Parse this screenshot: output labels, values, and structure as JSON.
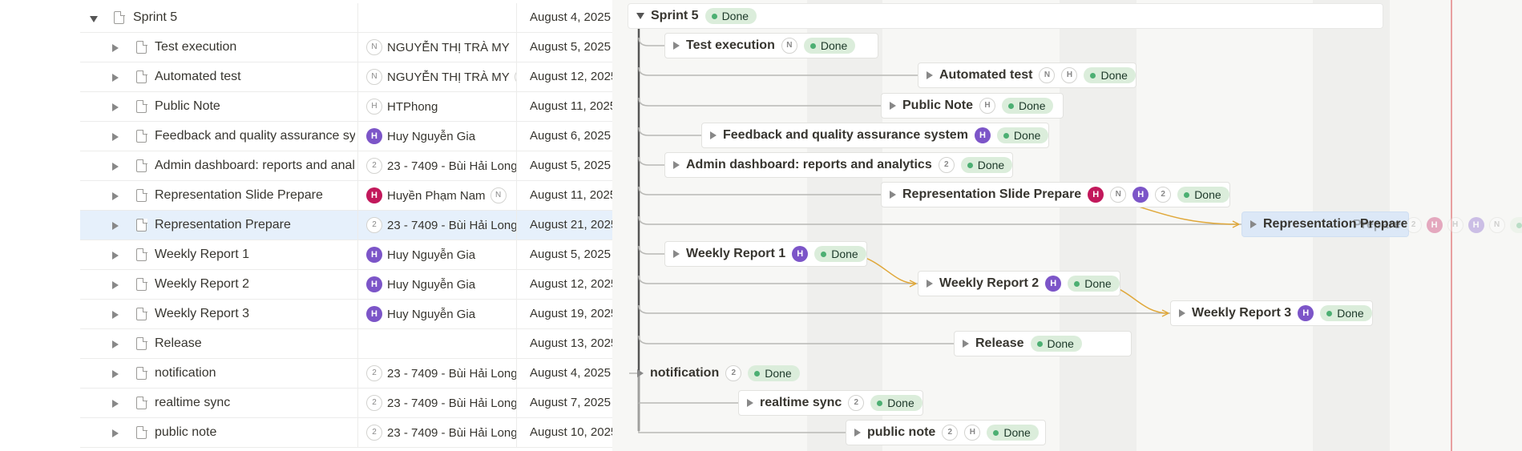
{
  "colors": {
    "status_done_bg": "#dbeddb",
    "status_done_dot": "#4caf72",
    "dependency_line": "#e0a83a",
    "selected_row": "#e6f0fb",
    "today_line": "#e8a0a0"
  },
  "table": {
    "rows": [
      {
        "title": "Sprint 5",
        "date": "August 4, 2025",
        "people": [],
        "people_text": ""
      },
      {
        "title": "Test execution",
        "date": "August 5, 2025",
        "people": [
          {
            "kind": "n",
            "label": "N"
          }
        ],
        "people_text": "NGUYỄN THỊ TRÀ MY"
      },
      {
        "title": "Automated test",
        "date": "August 12, 2025",
        "people": [
          {
            "kind": "n",
            "label": "N"
          }
        ],
        "people_text": "NGUYỄN THỊ TRÀ MY",
        "trailing": "H"
      },
      {
        "title": "Public Note",
        "date": "August 11, 2025",
        "people": [
          {
            "kind": "n",
            "label": "H"
          }
        ],
        "people_text": "HTPhong"
      },
      {
        "title": "Feedback and quality assurance system",
        "date": "August 6, 2025",
        "people": [
          {
            "kind": "purple",
            "label": "H"
          }
        ],
        "people_text": "Huy Nguyễn Gia"
      },
      {
        "title": "Admin dashboard: reports and analytics",
        "date": "August 5, 2025",
        "people": [
          {
            "kind": "num",
            "label": "2"
          }
        ],
        "people_text": "23 - 7409 - Bùi Hải Long"
      },
      {
        "title": "Representation Slide Prepare",
        "date": "August 11, 2025",
        "people": [
          {
            "kind": "red",
            "label": "H"
          }
        ],
        "people_text": "Huyền Phạm Nam",
        "trailing": "N"
      },
      {
        "title": "Representation Prepare",
        "date": "August 21, 2025",
        "people": [
          {
            "kind": "num",
            "label": "2"
          }
        ],
        "people_text": "23 - 7409 - Bùi Hải Long"
      },
      {
        "title": "Weekly Report 1",
        "date": "August 5, 2025",
        "people": [
          {
            "kind": "purple",
            "label": "H"
          }
        ],
        "people_text": "Huy Nguyễn Gia"
      },
      {
        "title": "Weekly Report 2",
        "date": "August 12, 2025",
        "people": [
          {
            "kind": "purple",
            "label": "H"
          }
        ],
        "people_text": "Huy Nguyễn Gia"
      },
      {
        "title": "Weekly Report 3",
        "date": "August 19, 2025",
        "people": [
          {
            "kind": "purple",
            "label": "H"
          }
        ],
        "people_text": "Huy Nguyễn Gia"
      },
      {
        "title": "Release",
        "date": "August 13, 2025",
        "people": [],
        "people_text": ""
      },
      {
        "title": "notification",
        "date": "August 4, 2025",
        "people": [
          {
            "kind": "num",
            "label": "2"
          }
        ],
        "people_text": "23 - 7409 - Bùi Hải Long"
      },
      {
        "title": "realtime sync",
        "date": "August 7, 2025",
        "people": [
          {
            "kind": "num",
            "label": "2"
          }
        ],
        "people_text": "23 - 7409 - Bùi Hải Long"
      },
      {
        "title": "public note",
        "date": "August 10, 2025",
        "people": [
          {
            "kind": "num",
            "label": "2"
          }
        ],
        "people_text": "23 - 7409 - Bùi Hải Long"
      }
    ]
  },
  "gantt": {
    "status_label": "Done",
    "bars": [
      {
        "name": "Sprint 5",
        "open": true,
        "avatars": []
      },
      {
        "name": "Test execution",
        "avatars": [
          {
            "kind": "n",
            "label": "N"
          }
        ]
      },
      {
        "name": "Automated test",
        "avatars": [
          {
            "kind": "n",
            "label": "N"
          },
          {
            "kind": "n",
            "label": "H"
          }
        ]
      },
      {
        "name": "Public Note",
        "avatars": [
          {
            "kind": "n",
            "label": "H"
          }
        ]
      },
      {
        "name": "Feedback and quality assurance system",
        "avatars": [
          {
            "kind": "purple",
            "label": "H"
          }
        ]
      },
      {
        "name": "Admin dashboard: reports and analytics",
        "avatars": [
          {
            "kind": "num",
            "label": "2"
          }
        ]
      },
      {
        "name": "Representation Slide Prepare",
        "avatars": [
          {
            "kind": "red",
            "label": "H"
          },
          {
            "kind": "n",
            "label": "N"
          },
          {
            "kind": "purple",
            "label": "H"
          },
          {
            "kind": "num",
            "label": "2"
          }
        ]
      },
      {
        "name": "Representation Prepare",
        "avatars": [],
        "faded_tail": "Prepare",
        "faded_avatars": [
          {
            "kind": "num",
            "label": "2"
          },
          {
            "kind": "red",
            "label": "H"
          },
          {
            "kind": "n",
            "label": "H"
          },
          {
            "kind": "purple",
            "label": "H"
          },
          {
            "kind": "n",
            "label": "N"
          }
        ],
        "faded_status": "D"
      },
      {
        "name": "Weekly Report 1",
        "avatars": [
          {
            "kind": "purple",
            "label": "H"
          }
        ]
      },
      {
        "name": "Weekly Report 2",
        "avatars": [
          {
            "kind": "purple",
            "label": "H"
          }
        ]
      },
      {
        "name": "Weekly Report 3",
        "avatars": [
          {
            "kind": "purple",
            "label": "H"
          }
        ]
      },
      {
        "name": "Release",
        "avatars": []
      },
      {
        "name": "notification",
        "avatars": [
          {
            "kind": "num",
            "label": "2"
          }
        ]
      },
      {
        "name": "realtime sync",
        "avatars": [
          {
            "kind": "num",
            "label": "2"
          }
        ]
      },
      {
        "name": "public note",
        "avatars": [
          {
            "kind": "num",
            "label": "2"
          },
          {
            "kind": "n",
            "label": "H"
          }
        ]
      }
    ]
  }
}
